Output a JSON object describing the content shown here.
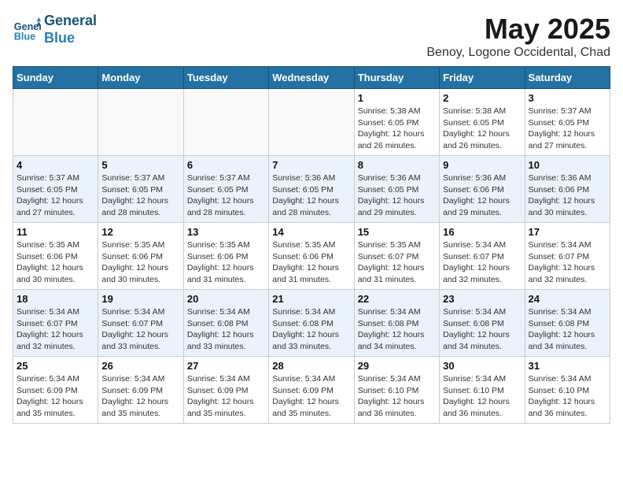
{
  "header": {
    "logo_line1": "General",
    "logo_line2": "Blue",
    "month_year": "May 2025",
    "location": "Benoy, Logone Occidental, Chad"
  },
  "days_of_week": [
    "Sunday",
    "Monday",
    "Tuesday",
    "Wednesday",
    "Thursday",
    "Friday",
    "Saturday"
  ],
  "weeks": [
    [
      {
        "day": "",
        "info": ""
      },
      {
        "day": "",
        "info": ""
      },
      {
        "day": "",
        "info": ""
      },
      {
        "day": "",
        "info": ""
      },
      {
        "day": "1",
        "info": "Sunrise: 5:38 AM\nSunset: 6:05 PM\nDaylight: 12 hours\nand 26 minutes."
      },
      {
        "day": "2",
        "info": "Sunrise: 5:38 AM\nSunset: 6:05 PM\nDaylight: 12 hours\nand 26 minutes."
      },
      {
        "day": "3",
        "info": "Sunrise: 5:37 AM\nSunset: 6:05 PM\nDaylight: 12 hours\nand 27 minutes."
      }
    ],
    [
      {
        "day": "4",
        "info": "Sunrise: 5:37 AM\nSunset: 6:05 PM\nDaylight: 12 hours\nand 27 minutes."
      },
      {
        "day": "5",
        "info": "Sunrise: 5:37 AM\nSunset: 6:05 PM\nDaylight: 12 hours\nand 28 minutes."
      },
      {
        "day": "6",
        "info": "Sunrise: 5:37 AM\nSunset: 6:05 PM\nDaylight: 12 hours\nand 28 minutes."
      },
      {
        "day": "7",
        "info": "Sunrise: 5:36 AM\nSunset: 6:05 PM\nDaylight: 12 hours\nand 28 minutes."
      },
      {
        "day": "8",
        "info": "Sunrise: 5:36 AM\nSunset: 6:05 PM\nDaylight: 12 hours\nand 29 minutes."
      },
      {
        "day": "9",
        "info": "Sunrise: 5:36 AM\nSunset: 6:06 PM\nDaylight: 12 hours\nand 29 minutes."
      },
      {
        "day": "10",
        "info": "Sunrise: 5:36 AM\nSunset: 6:06 PM\nDaylight: 12 hours\nand 30 minutes."
      }
    ],
    [
      {
        "day": "11",
        "info": "Sunrise: 5:35 AM\nSunset: 6:06 PM\nDaylight: 12 hours\nand 30 minutes."
      },
      {
        "day": "12",
        "info": "Sunrise: 5:35 AM\nSunset: 6:06 PM\nDaylight: 12 hours\nand 30 minutes."
      },
      {
        "day": "13",
        "info": "Sunrise: 5:35 AM\nSunset: 6:06 PM\nDaylight: 12 hours\nand 31 minutes."
      },
      {
        "day": "14",
        "info": "Sunrise: 5:35 AM\nSunset: 6:06 PM\nDaylight: 12 hours\nand 31 minutes."
      },
      {
        "day": "15",
        "info": "Sunrise: 5:35 AM\nSunset: 6:07 PM\nDaylight: 12 hours\nand 31 minutes."
      },
      {
        "day": "16",
        "info": "Sunrise: 5:34 AM\nSunset: 6:07 PM\nDaylight: 12 hours\nand 32 minutes."
      },
      {
        "day": "17",
        "info": "Sunrise: 5:34 AM\nSunset: 6:07 PM\nDaylight: 12 hours\nand 32 minutes."
      }
    ],
    [
      {
        "day": "18",
        "info": "Sunrise: 5:34 AM\nSunset: 6:07 PM\nDaylight: 12 hours\nand 32 minutes."
      },
      {
        "day": "19",
        "info": "Sunrise: 5:34 AM\nSunset: 6:07 PM\nDaylight: 12 hours\nand 33 minutes."
      },
      {
        "day": "20",
        "info": "Sunrise: 5:34 AM\nSunset: 6:08 PM\nDaylight: 12 hours\nand 33 minutes."
      },
      {
        "day": "21",
        "info": "Sunrise: 5:34 AM\nSunset: 6:08 PM\nDaylight: 12 hours\nand 33 minutes."
      },
      {
        "day": "22",
        "info": "Sunrise: 5:34 AM\nSunset: 6:08 PM\nDaylight: 12 hours\nand 34 minutes."
      },
      {
        "day": "23",
        "info": "Sunrise: 5:34 AM\nSunset: 6:08 PM\nDaylight: 12 hours\nand 34 minutes."
      },
      {
        "day": "24",
        "info": "Sunrise: 5:34 AM\nSunset: 6:08 PM\nDaylight: 12 hours\nand 34 minutes."
      }
    ],
    [
      {
        "day": "25",
        "info": "Sunrise: 5:34 AM\nSunset: 6:09 PM\nDaylight: 12 hours\nand 35 minutes."
      },
      {
        "day": "26",
        "info": "Sunrise: 5:34 AM\nSunset: 6:09 PM\nDaylight: 12 hours\nand 35 minutes."
      },
      {
        "day": "27",
        "info": "Sunrise: 5:34 AM\nSunset: 6:09 PM\nDaylight: 12 hours\nand 35 minutes."
      },
      {
        "day": "28",
        "info": "Sunrise: 5:34 AM\nSunset: 6:09 PM\nDaylight: 12 hours\nand 35 minutes."
      },
      {
        "day": "29",
        "info": "Sunrise: 5:34 AM\nSunset: 6:10 PM\nDaylight: 12 hours\nand 36 minutes."
      },
      {
        "day": "30",
        "info": "Sunrise: 5:34 AM\nSunset: 6:10 PM\nDaylight: 12 hours\nand 36 minutes."
      },
      {
        "day": "31",
        "info": "Sunrise: 5:34 AM\nSunset: 6:10 PM\nDaylight: 12 hours\nand 36 minutes."
      }
    ]
  ]
}
